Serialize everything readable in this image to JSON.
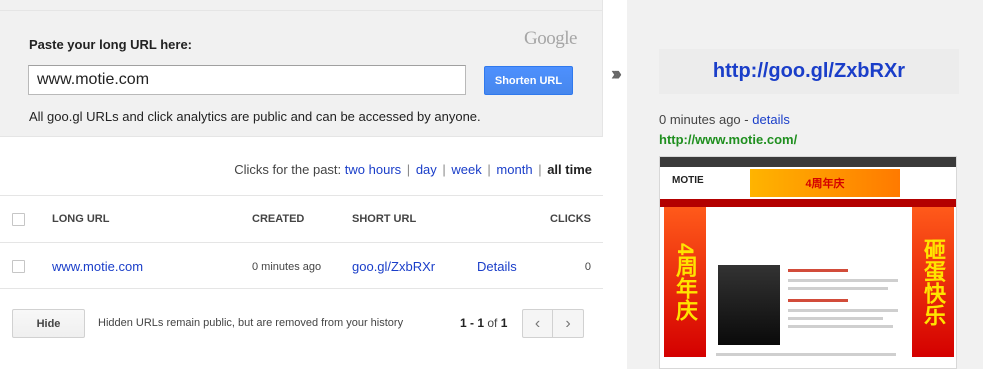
{
  "shortener": {
    "label": "Paste your long URL here:",
    "logo": "Google",
    "input_value": "www.motie.com",
    "button": "Shorten URL",
    "note": "All goo.gl URLs and click analytics are public and can be accessed by anyone."
  },
  "clicks_filter": {
    "prefix": "Clicks for the past:",
    "options": [
      "two hours",
      "day",
      "week",
      "month"
    ],
    "current": "all time"
  },
  "table": {
    "headers": {
      "long_url": "LONG URL",
      "created": "CREATED",
      "short_url": "SHORT URL",
      "clicks": "CLICKS"
    },
    "rows": [
      {
        "long_url": "www.motie.com",
        "created": "0 minutes ago",
        "short_url": "goo.gl/ZxbRXr",
        "details": "Details",
        "clicks": "0"
      }
    ]
  },
  "footer": {
    "hide_button": "Hide",
    "hidden_note": "Hidden URLs remain public, but are removed from your history",
    "pager_range": "1 - 1",
    "pager_of": "of",
    "pager_total": "1"
  },
  "result": {
    "short_url": "http://goo.gl/ZxbRXr",
    "time": "0 minutes ago",
    "dash": "-",
    "details": "details",
    "long_url": "http://www.motie.com/"
  },
  "thumbnail": {
    "logo_text": "MOTIE",
    "banner_text": "4周年庆",
    "left_banner": "4周年庆",
    "right_banner": "砸蛋快乐"
  },
  "colors": {
    "link": "#1a3ec9",
    "button_blue": "#4d90fe",
    "green_url": "#1f8f1f",
    "panel_bg": "#f1f1f1"
  },
  "icons": [
    "double-chevron-right-icon",
    "chevron-left-icon",
    "chevron-right-icon",
    "checkbox-icon"
  ]
}
